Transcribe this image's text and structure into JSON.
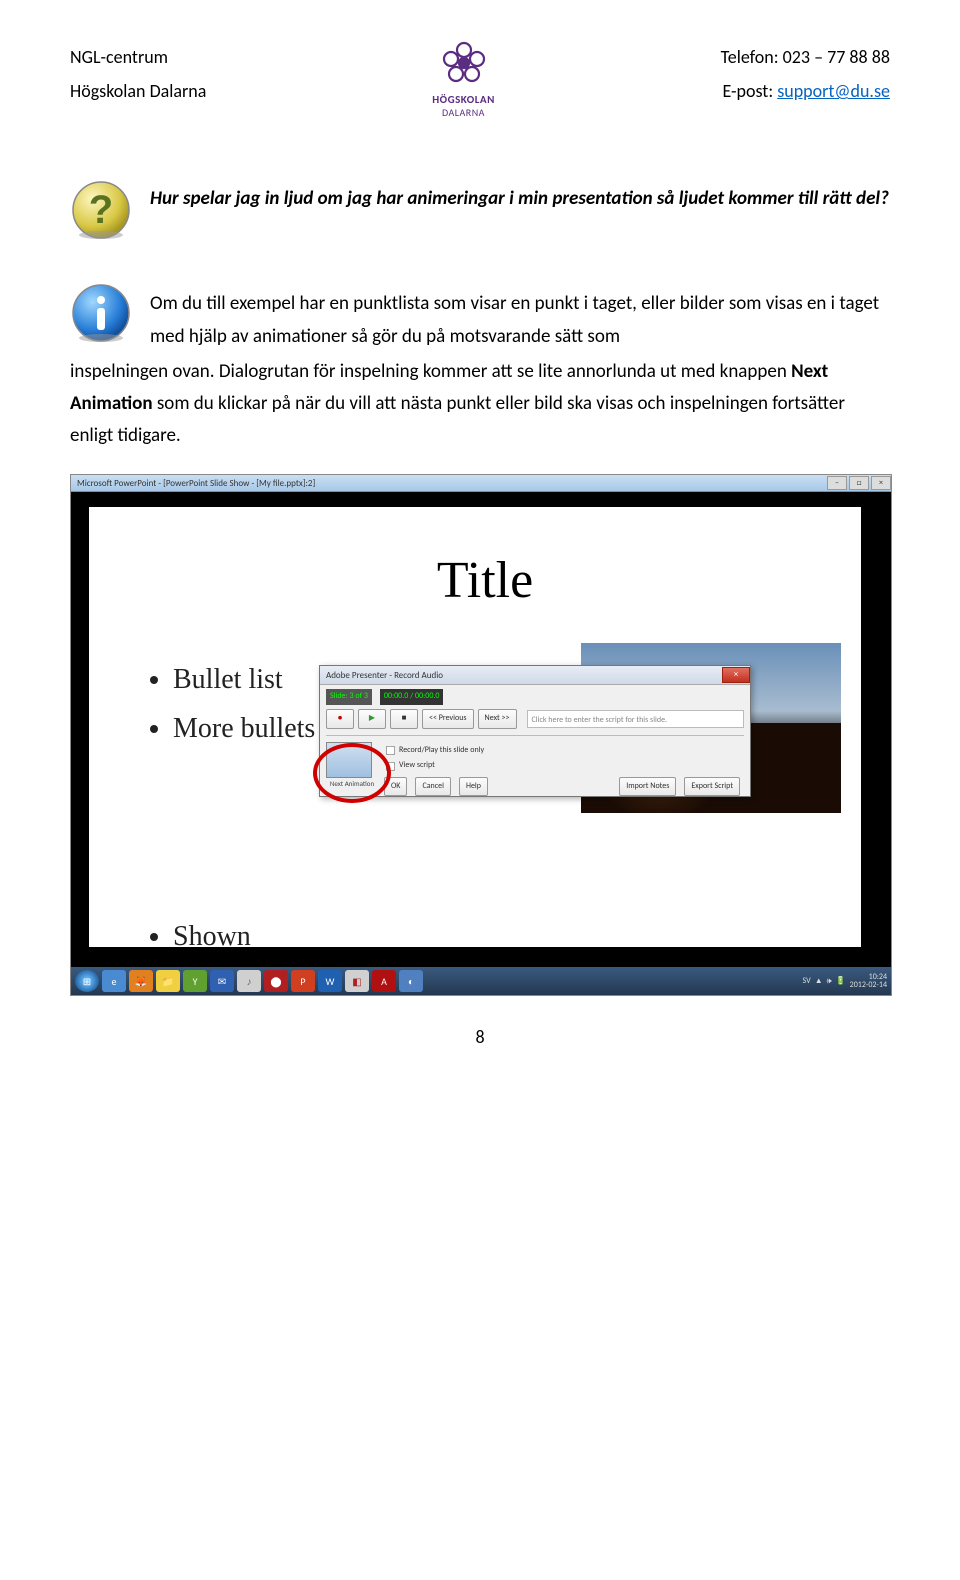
{
  "header": {
    "left_line1": "NGL-centrum",
    "left_line2": "Högskolan Dalarna",
    "right_line1": "Telefon: 023 – 77 88 88",
    "right_line2_label": "E-post: ",
    "right_line2_email": "support@du.se",
    "logo_text1": "HÖGSKOLAN",
    "logo_text2": "DALARNA"
  },
  "question": "Hur spelar jag in ljud om jag har animeringar i min presentation så ljudet kommer till rätt del?",
  "info_part1": "Om du till exempel har en punktlista som visar en punkt i taget, eller bilder som visas en i taget med hjälp av animationer så gör du på motsvarande sätt som",
  "info_part2a": "inspelningen ovan. Dialogrutan för inspelning kommer att se lite annorlunda ut med knappen ",
  "info_part2_bold": "Next Animation",
  "info_part2b": " som du klickar på när du vill att nästa punkt eller bild ska visas och inspelningen fortsätter enligt tidigare.",
  "screenshot": {
    "window_title": "Microsoft PowerPoint - [PowerPoint Slide Show - [My file.pptx]:2]",
    "slide": {
      "title": "Title",
      "bullets": [
        "Bullet list",
        "More bullets"
      ],
      "shown": "Shown"
    },
    "dialog": {
      "title": "Adobe Presenter - Record Audio",
      "slide_counter": "Slide: 3 of 3",
      "timer": "00:00.0 / 00:00.0",
      "prev": "<< Previous",
      "next": "Next >>",
      "script_placeholder": "Click here to enter the script for this slide.",
      "record_play": "Record/Play this slide only",
      "view_script": "View script",
      "next_animation": "Next Animation",
      "ok": "OK",
      "cancel": "Cancel",
      "help": "Help",
      "import_notes": "Import Notes",
      "export_script": "Export Script"
    },
    "taskbar": {
      "lang": "SV",
      "time": "10:24",
      "date": "2012-02-14"
    }
  },
  "page_number": "8"
}
